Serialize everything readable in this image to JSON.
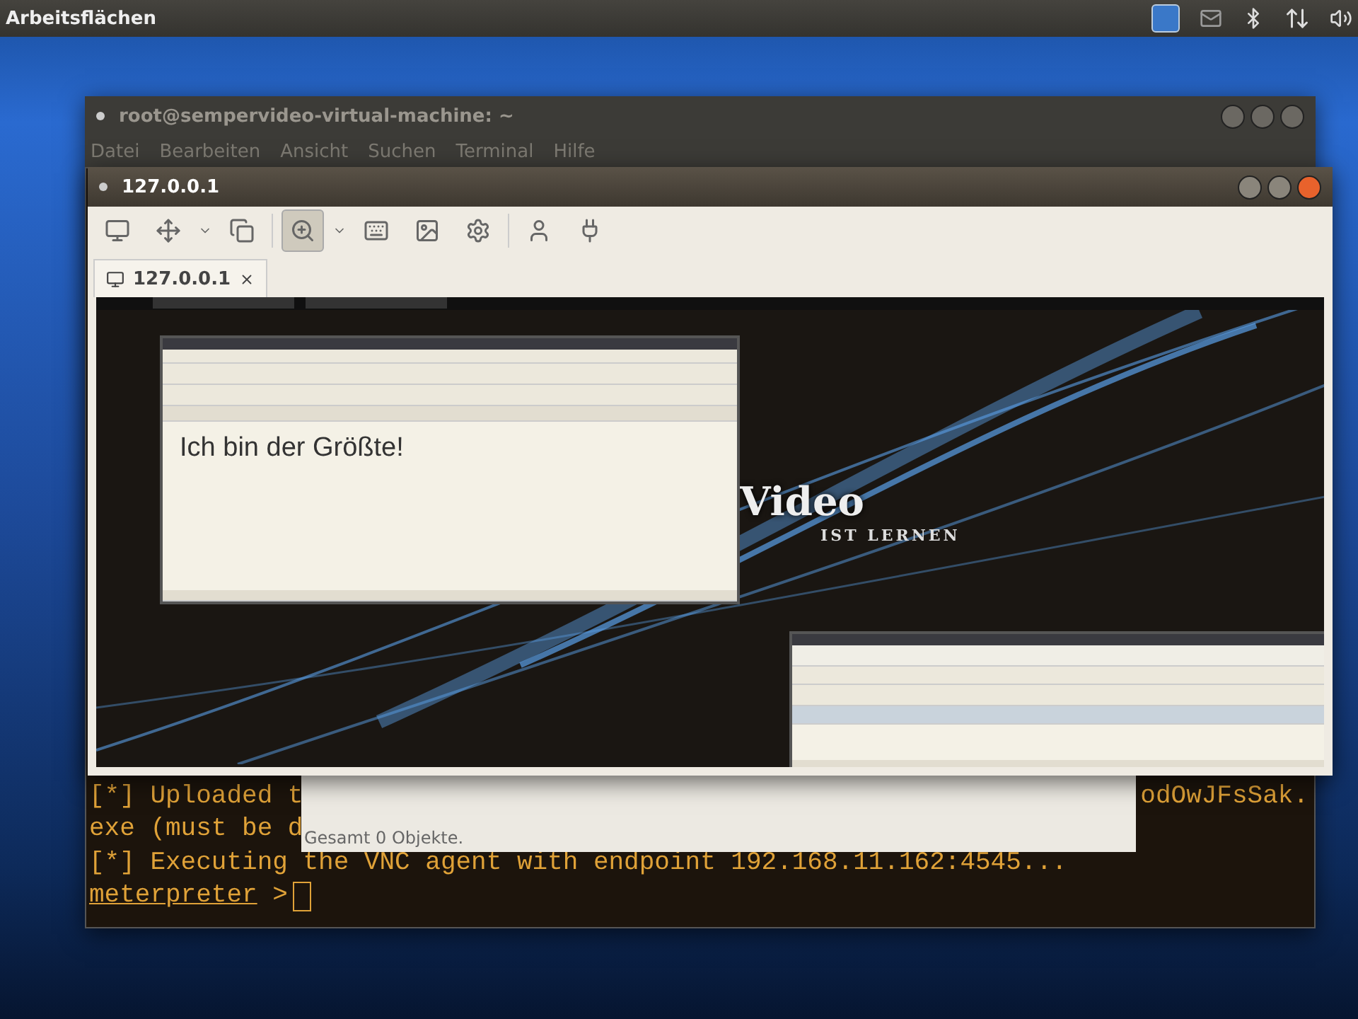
{
  "top_panel": {
    "title": "Arbeitsflächen"
  },
  "terminal": {
    "title": "root@sempervideo-virtual-machine: ~",
    "menu": [
      "Datei",
      "Bearbeiten",
      "Ansicht",
      "Suchen",
      "Terminal",
      "Hilfe"
    ],
    "lines": [
      {
        "kind": "output",
        "left": "[*] Uploaded t",
        "right": "odOwJFsSak."
      },
      {
        "kind": "output",
        "left": "exe (must be d"
      },
      {
        "kind": "output",
        "left": "[*] Executing the VNC agent with endpoint 192.168.11.162:4545..."
      },
      {
        "kind": "prompt",
        "left": "meterpreter",
        "symbol": ">"
      }
    ]
  },
  "file_manager": {
    "status": "Gesamt 0 Objekte."
  },
  "vnc_window": {
    "title": "127.0.0.1",
    "tools": [
      {
        "pressed": false
      },
      {
        "pressed": false
      },
      {
        "pressed": false
      },
      {
        "pressed": true
      },
      {
        "pressed": false
      },
      {
        "pressed": false
      },
      {
        "pressed": false
      },
      {
        "pressed": false
      },
      {
        "pressed": false
      }
    ],
    "tabs": [
      {
        "label": "127.0.0.1",
        "selected": true
      }
    ],
    "remote": {
      "logo": "Video",
      "tagline": "IST LERNEN",
      "document_text": "Ich bin der Größte!"
    }
  }
}
